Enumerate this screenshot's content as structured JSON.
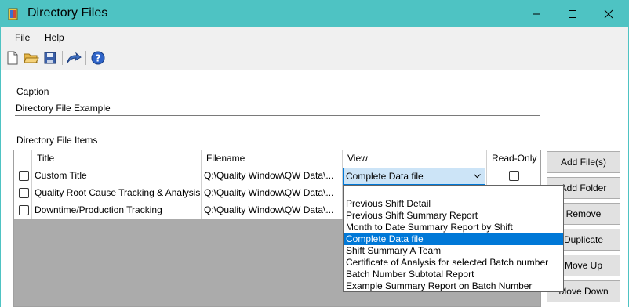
{
  "window": {
    "title": "Directory Files"
  },
  "menu": {
    "file": "File",
    "help": "Help"
  },
  "toolbar": {
    "icons": [
      "new-file-icon",
      "open-folder-icon",
      "save-icon",
      "export-icon",
      "help-icon"
    ]
  },
  "form": {
    "caption_label": "Caption",
    "caption_value": "Directory File Example",
    "items_label": "Directory File Items"
  },
  "grid": {
    "columns": [
      "Title",
      "Filename",
      "View",
      "Read-Only"
    ],
    "rows": [
      {
        "title": "Custom Title",
        "filename": "Q:\\Quality Window\\QW Data\\...",
        "view": "Complete Data file"
      },
      {
        "title": "Quality Root Cause Tracking & Analysis",
        "filename": "Q:\\Quality Window\\QW Data\\...",
        "view": ""
      },
      {
        "title": "Downtime/Production Tracking",
        "filename": "Q:\\Quality Window\\QW Data\\...",
        "view": ""
      }
    ]
  },
  "dropdown": {
    "selected": "Complete Data file",
    "options": [
      "",
      "Previous Shift Detail",
      "Previous Shift Summary Report",
      "Month to Date Summary Report by Shift",
      "Complete Data file",
      "Shift Summary A Team",
      "Certificate of Analysis for selected Batch number",
      "Batch Number Subtotal Report",
      "Example Summary Report on Batch Number"
    ]
  },
  "buttons": {
    "add_files": "Add File(s)",
    "add_folder": "Add Folder",
    "remove": "Remove",
    "duplicate": "Duplicate",
    "move_up": "Move Up",
    "move_down": "Move Down"
  },
  "colors": {
    "titlebar": "#4ec3c3",
    "selection": "#0078d7"
  }
}
